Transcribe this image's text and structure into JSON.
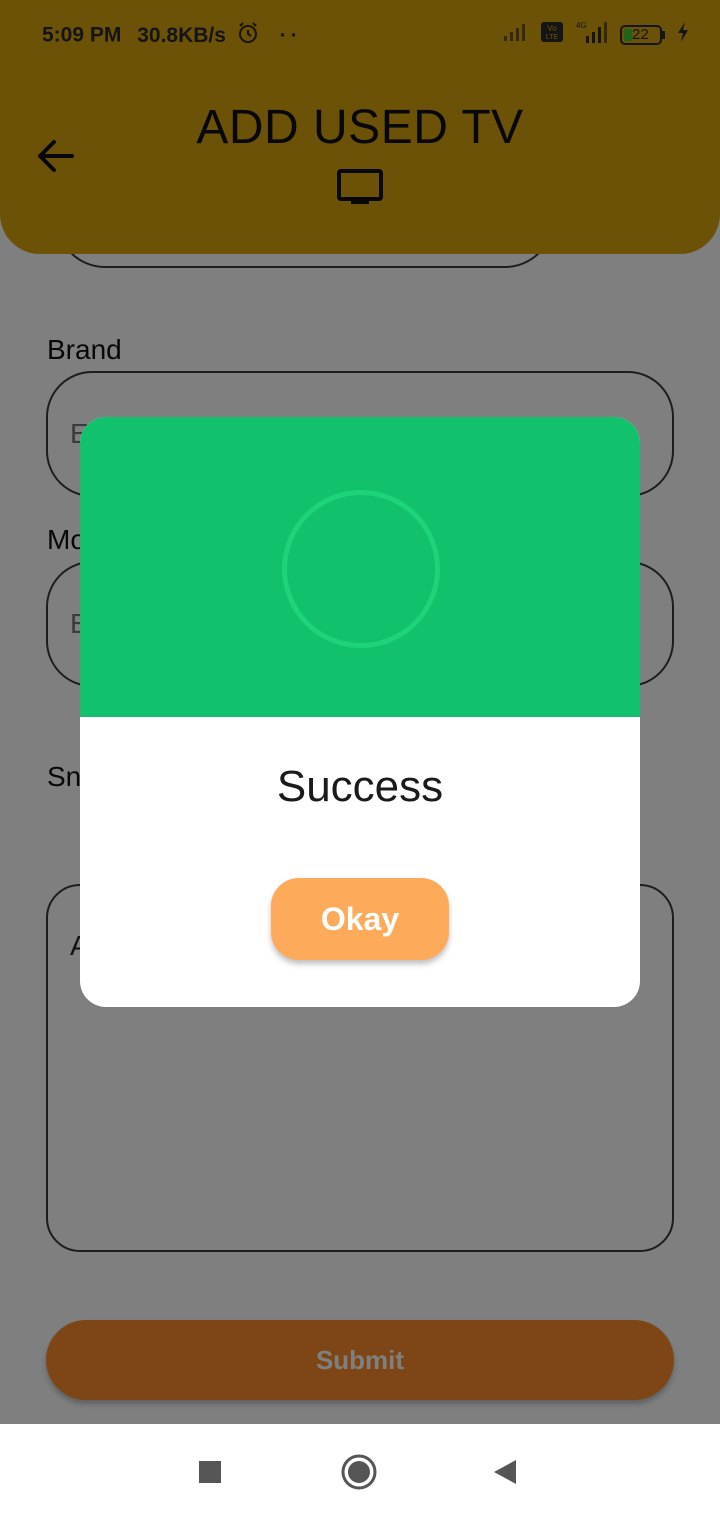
{
  "status_bar": {
    "time": "5:09 PM",
    "net_speed": "30.8KB/s",
    "battery": "22",
    "icons": [
      "alarm-icon",
      "signal-icon",
      "volte-icon",
      "signal-4g-icon",
      "battery-icon",
      "charging-icon"
    ]
  },
  "app_bar": {
    "title": "ADD USED TV",
    "back_icon": "arrow-left-icon",
    "title_icon": "tv-icon",
    "color": "#d8a50d"
  },
  "form": {
    "brand_label": "Brand",
    "brand_hint": "E",
    "model_label": "Mo",
    "model_hint": "E",
    "screen_label": "Sn",
    "description_hint": "A",
    "submit_label": "Submit",
    "submit_color": "#fc8d2c"
  },
  "dialog": {
    "title": "Success",
    "ok_label": "Okay",
    "header_color": "#12c16b",
    "button_color": "#fdaa5b"
  },
  "nav_bar": {
    "icons": [
      "recents-square-icon",
      "home-circle-icon",
      "back-triangle-icon"
    ]
  }
}
